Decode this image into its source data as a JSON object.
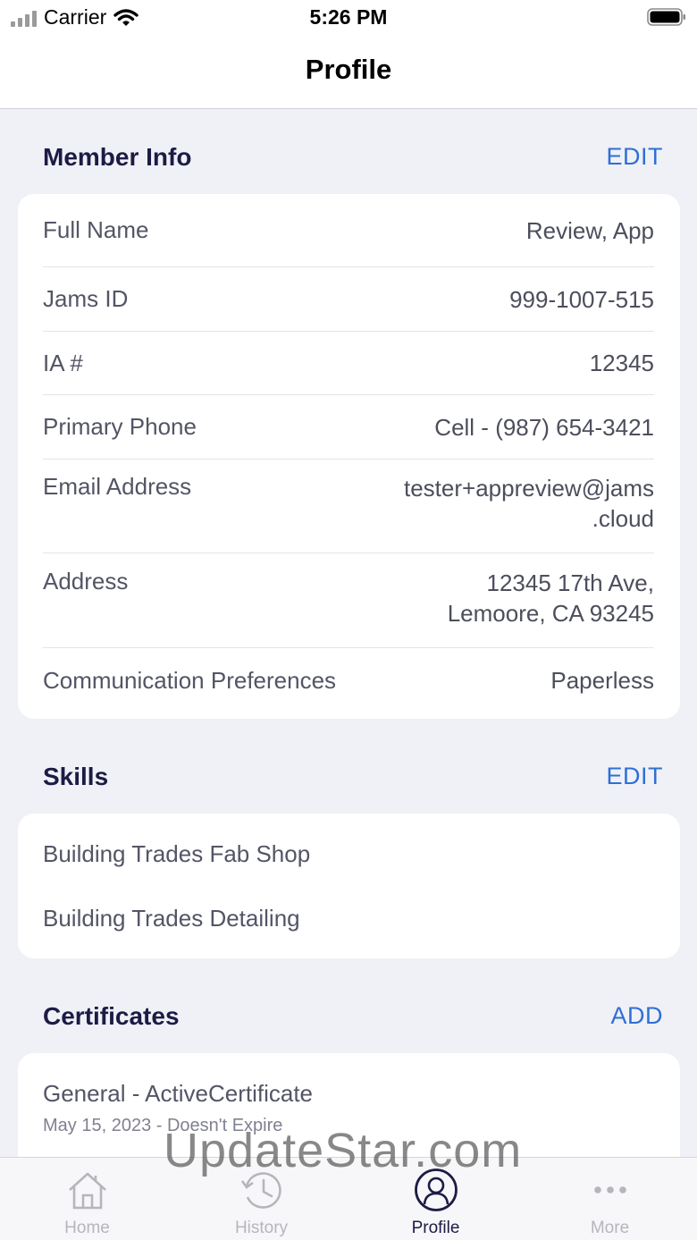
{
  "status_bar": {
    "carrier": "Carrier",
    "time": "5:26 PM"
  },
  "nav": {
    "title": "Profile"
  },
  "member_info": {
    "title": "Member Info",
    "action": "EDIT",
    "rows": [
      {
        "label": "Full Name",
        "value": "Review, App"
      },
      {
        "label": "Jams ID",
        "value": "999-1007-515"
      },
      {
        "label": "IA #",
        "value": "12345"
      },
      {
        "label": "Primary Phone",
        "value": "Cell - (987) 654-3421"
      },
      {
        "label": "Email Address",
        "value_line1": "tester+appreview@jams",
        "value_line2": ".cloud"
      },
      {
        "label": "Address",
        "value_line1": "12345 17th Ave,",
        "value_line2": "Lemoore, CA 93245"
      },
      {
        "label": "Communication Preferences",
        "value": "Paperless"
      }
    ]
  },
  "skills": {
    "title": "Skills",
    "action": "EDIT",
    "items": [
      "Building Trades Fab Shop",
      "Building Trades Detailing"
    ]
  },
  "certificates": {
    "title": "Certificates",
    "action": "ADD",
    "items": [
      {
        "title": "General - ActiveCertificate",
        "subtitle": "May 15, 2023 - Doesn't Expire"
      }
    ]
  },
  "watermark": "UpdateStar.com",
  "tabs": [
    {
      "label": "Home",
      "icon": "home-icon"
    },
    {
      "label": "History",
      "icon": "history-icon"
    },
    {
      "label": "Profile",
      "icon": "profile-icon",
      "active": true
    },
    {
      "label": "More",
      "icon": "more-icon"
    }
  ],
  "colors": {
    "accent": "#2f6fd6",
    "heading": "#1d1b45",
    "background": "#eff1f6"
  }
}
